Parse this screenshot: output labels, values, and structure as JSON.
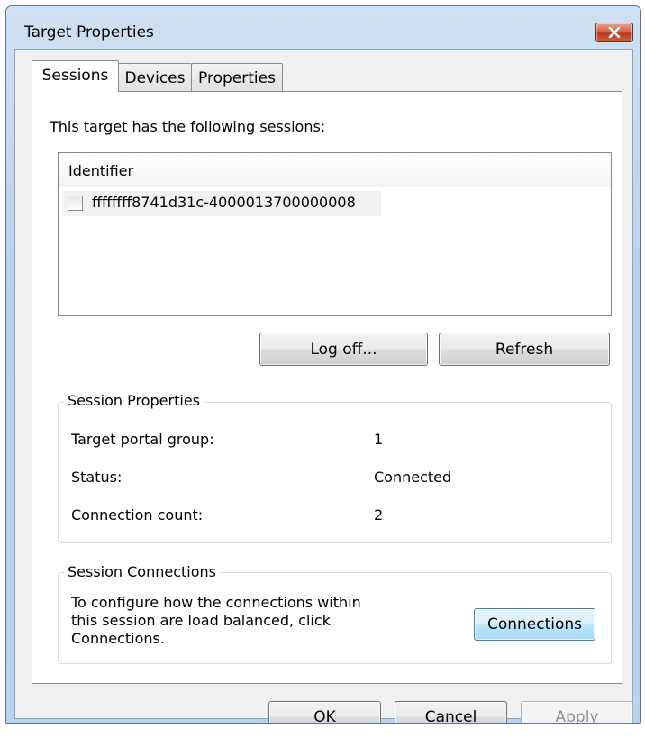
{
  "window": {
    "title": "Target Properties"
  },
  "tabs": [
    {
      "label": "Sessions",
      "active": true
    },
    {
      "label": "Devices",
      "active": false
    },
    {
      "label": "Properties",
      "active": false
    }
  ],
  "sessions": {
    "intro": "This target has the following sessions:",
    "list": {
      "column_header": "Identifier",
      "rows": [
        {
          "identifier": "ffffffff8741d31c-4000013700000008",
          "checked": false
        }
      ]
    },
    "buttons": {
      "log_off": "Log off...",
      "refresh": "Refresh"
    }
  },
  "session_properties": {
    "title": "Session Properties",
    "fields": [
      {
        "label": "Target portal group:",
        "value": "1"
      },
      {
        "label": "Status:",
        "value": "Connected"
      },
      {
        "label": "Connection count:",
        "value": "2"
      }
    ]
  },
  "session_connections": {
    "title": "Session Connections",
    "description_lines": [
      "To configure how the connections within",
      "this session are load balanced, click",
      "Connections."
    ],
    "button": "Connections"
  },
  "footer": {
    "ok": "OK",
    "cancel": "Cancel",
    "apply": "Apply"
  },
  "colors": {
    "titlebar": "#bcd3ec",
    "close_button": "#c7432b",
    "default_button_border": "#3c7fb1"
  }
}
